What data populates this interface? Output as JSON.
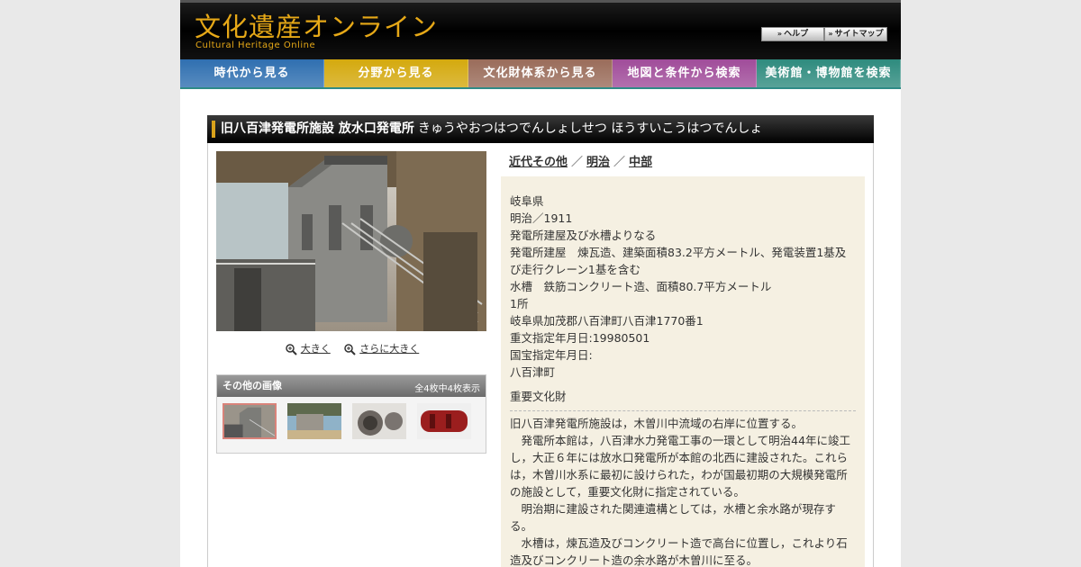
{
  "header": {
    "logo_title": "文化遺産オンライン",
    "logo_subtitle": "Cultural Heritage Online",
    "help_label": "ヘルプ",
    "sitemap_label": "サイトマップ"
  },
  "nav": [
    {
      "label": "時代から見る",
      "color": "#2f6fb0"
    },
    {
      "label": "分野から見る",
      "color": "#d4a90e"
    },
    {
      "label": "文化財体系から見る",
      "color": "#9a6c5a"
    },
    {
      "label": "地図と条件から検索",
      "color": "#a04c9a"
    },
    {
      "label": "美術館・博物館を検索",
      "color": "#2e8b7e"
    }
  ],
  "title": {
    "main": "旧八百津発電所施設 放水口発電所",
    "reading": "きゅうやおつはつでんしょしせつ ほうすいこうはつでんしょ"
  },
  "zoom": {
    "larger": "大きく",
    "largest": "さらに大きく"
  },
  "other_images": {
    "heading": "その他の画像",
    "count": "全4枚中4枚表示"
  },
  "breadcrumbs": [
    "近代その他",
    "明治",
    "中部"
  ],
  "info": {
    "prefecture": "岐阜県",
    "era": "明治／1911",
    "composition": "発電所建屋及び水槽よりなる",
    "building": "発電所建屋　煉瓦造、建築面積83.2平方メートル、発電装置1基及び走行クレーン1基を含む",
    "tank": "水槽　鉄筋コンクリート造、面積80.7平方メートル",
    "quantity": "1所",
    "address": "岐阜県加茂郡八百津町八百津1770番1",
    "designation_date": "重文指定年月日:19980501",
    "national_treasure_date": "国宝指定年月日:",
    "owner": "八百津町",
    "category": "重要文化財"
  },
  "description": [
    "旧八百津発電所施設は，木曽川中流域の右岸に位置する。",
    "　発電所本館は，八百津水力発電工事の一環として明治44年に竣工し，大正６年には放水口発電所が本館の北西に建設された。これらは，木曽川水系に最初に設けられた，わが国最初期の大規模発電所の施設として，重要文化財に指定されている。",
    "　明治期に建設された関連遺構としては，水槽と余水路が現存する。",
    "　水槽は，煉瓦造及びコンクリート造で高台に位置し，これより石造及びコンクリート造の余水路が木曽川に至る。"
  ]
}
